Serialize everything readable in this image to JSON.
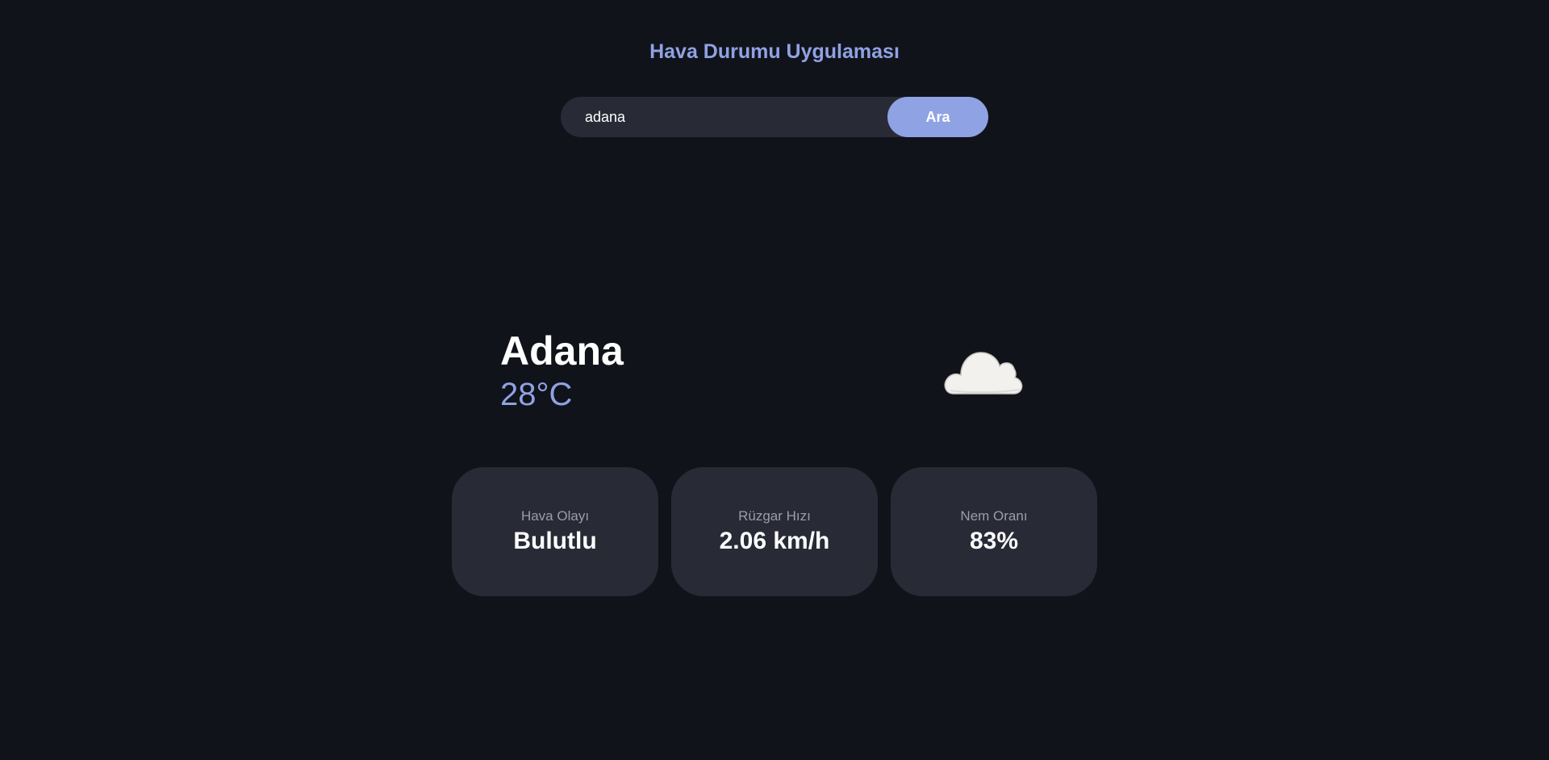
{
  "app": {
    "title": "Hava Durumu Uygulaması"
  },
  "search": {
    "value": "adana",
    "button_label": "Ara"
  },
  "current": {
    "city": "Adana",
    "temperature": "28°C",
    "icon": "cloud-icon"
  },
  "cards": [
    {
      "label": "Hava Olayı",
      "value": "Bulutlu"
    },
    {
      "label": "Rüzgar Hızı",
      "value": "2.06 km/h"
    },
    {
      "label": "Nem Oranı",
      "value": "83%"
    }
  ],
  "colors": {
    "background": "#11131a",
    "accent": "#8fa2e4",
    "card": "#282a36",
    "text": "#ffffff",
    "muted": "#9a9eaa"
  }
}
